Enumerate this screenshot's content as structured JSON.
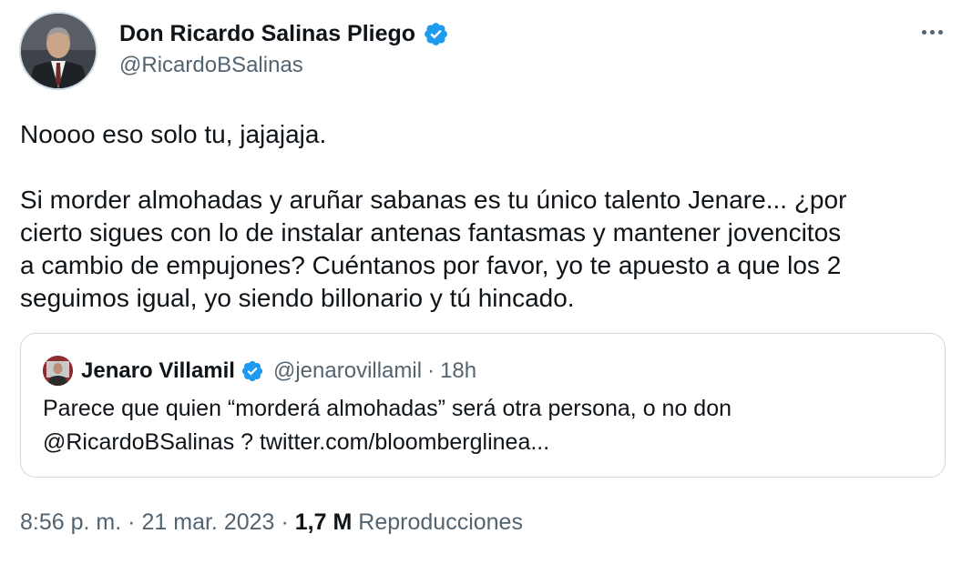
{
  "author": {
    "name": "Don Ricardo Salinas Pliego",
    "handle": "@RicardoBSalinas",
    "verified_icon": "verified-badge-icon",
    "verified_color": "#1d9bf0"
  },
  "more_icon": "more-options-icon",
  "tweet": {
    "line1": "Noooo eso solo tu, jajajaja.",
    "paragraph2": [
      "Si morder almohadas y aruñar sabanas es tu único talento Jenare... ¿por",
      "cierto sigues con lo de instalar antenas fantasmas y mantener jovencitos",
      "a cambio de empujones? Cuéntanos por favor, yo te apuesto a que los 2",
      "seguimos igual, yo siendo billonario y tú hincado."
    ]
  },
  "quoted_tweet": {
    "name": "Jenaro Villamil",
    "handle": "@jenarovillamil",
    "separator": "·",
    "time": "18h",
    "text_lines": [
      "Parece que quien “morderá almohadas” será otra persona, o no don",
      "@RicardoBSalinas ? twitter.com/bloomberglinea..."
    ]
  },
  "meta": {
    "time": "8:56 p. m.",
    "separator": "·",
    "date": "21 mar. 2023",
    "views_count": "1,7 M",
    "views_label": "Reproducciones"
  },
  "colors": {
    "text": "#0f1419",
    "secondary": "#536471",
    "border": "#cfd9de",
    "verified": "#1d9bf0"
  }
}
